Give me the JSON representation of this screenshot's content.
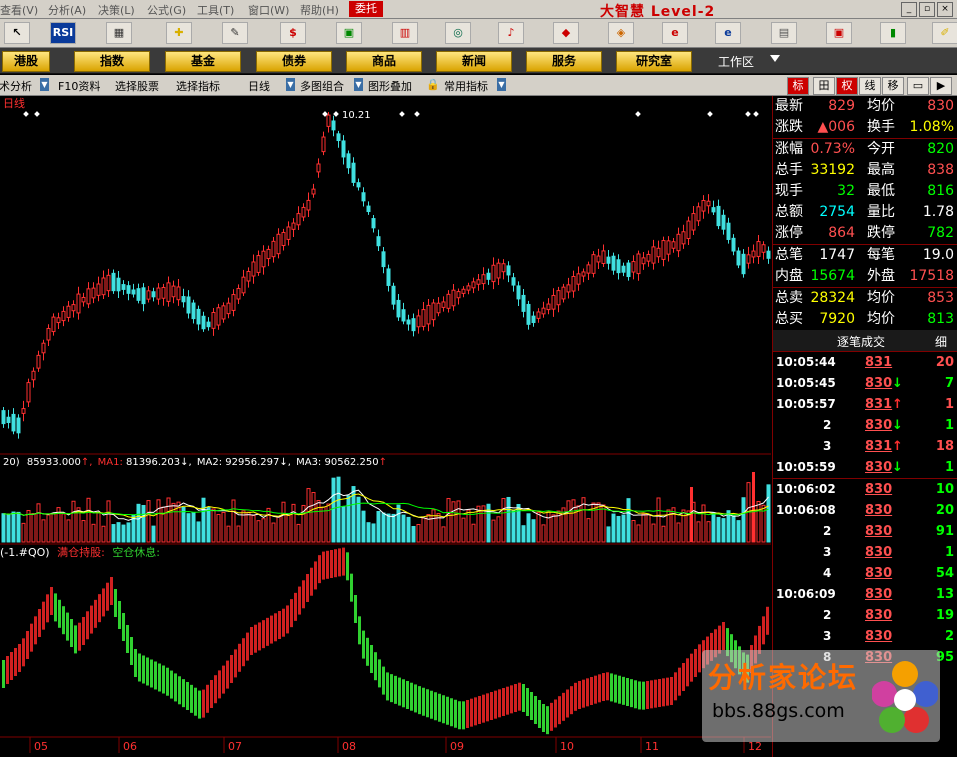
{
  "menubar": {
    "items": [
      "查看(V)",
      "分析(A)",
      "决策(L)",
      "公式(G)",
      "工具(T)",
      "窗口(W)",
      "帮助(H)"
    ],
    "entrust": "委托",
    "brand": "大智慧 Level-2"
  },
  "toolbar": {
    "rsi_label": "RSI",
    "dollar_label": "$"
  },
  "nav": {
    "buttons": [
      "港股",
      "指数",
      "基金",
      "债券",
      "商品",
      "新闻",
      "服务",
      "研究室"
    ],
    "workarea": "工作区"
  },
  "funcbar": {
    "items": [
      "技术分析",
      "F10资料",
      "选择股票",
      "选择指标",
      "日线",
      "多图组合",
      "图形叠加",
      "常用指标"
    ],
    "right_tabs": [
      "标",
      "田",
      "权",
      "线",
      "移"
    ]
  },
  "main_chart": {
    "period_label": "日线",
    "max_label": "10.21"
  },
  "volume": {
    "prefix": "20)",
    "vol_value": "85933.000",
    "ma1_label": "MA1:",
    "ma1_value": "81396.203",
    "ma2_label": "MA2:",
    "ma2_value": "92956.297",
    "ma3_label": "MA3:",
    "ma3_value": "90562.250"
  },
  "indicator": {
    "prefix": "(-1.#QO)",
    "label1": "满仓持股:",
    "label2": "空仓休息:"
  },
  "months": [
    "05",
    "06",
    "07",
    "08",
    "09",
    "10",
    "11",
    "12"
  ],
  "quote": {
    "rows": [
      {
        "l1": "最新",
        "v1": "829",
        "c1": "#ff5050",
        "l2": "均价",
        "v2": "830",
        "c2": "#ff5050"
      },
      {
        "l1": "涨跌",
        "v1": "▲006",
        "c1": "#ff5050",
        "l2": "换手",
        "v2": "1.08%",
        "c2": "#ffff00"
      },
      {
        "l1": "涨幅",
        "v1": "0.73%",
        "c1": "#ff5050",
        "l2": "今开",
        "v2": "820",
        "c2": "#00ff00"
      },
      {
        "l1": "总手",
        "v1": "33192",
        "c1": "#ffff00",
        "l2": "最高",
        "v2": "838",
        "c2": "#ff5050"
      },
      {
        "l1": "现手",
        "v1": "32",
        "c1": "#00ff00",
        "l2": "最低",
        "v2": "816",
        "c2": "#00ff00"
      },
      {
        "l1": "总额",
        "v1": "2754",
        "c1": "#00ffff",
        "l2": "量比",
        "v2": "1.78",
        "c2": "#ffffff"
      },
      {
        "l1": "涨停",
        "v1": "864",
        "c1": "#ff5050",
        "l2": "跌停",
        "v2": "782",
        "c2": "#00ff00"
      },
      {
        "l1": "总笔",
        "v1": "1747",
        "c1": "#ffffff",
        "l2": "每笔",
        "v2": "19.0",
        "c2": "#ffffff"
      },
      {
        "l1": "内盘",
        "v1": "15674",
        "c1": "#00ff00",
        "l2": "外盘",
        "v2": "17518",
        "c2": "#ff5050"
      },
      {
        "l1": "总卖",
        "v1": "28324",
        "c1": "#ffff00",
        "l2": "均价",
        "v2": "853",
        "c2": "#ff5050"
      },
      {
        "l1": "总买",
        "v1": "7920",
        "c1": "#ffff00",
        "l2": "均价",
        "v2": "813",
        "c2": "#00ff00"
      }
    ]
  },
  "ticks": {
    "header": "逐笔成交",
    "header_right": "细",
    "rows": [
      {
        "t": "10:05:44",
        "p": "831",
        "pc": "#ff5050",
        "a": "",
        "v": "20",
        "vc": "#ff5050"
      },
      {
        "t": "10:05:45",
        "p": "830",
        "pc": "#ff5050",
        "a": "↓",
        "v": "7",
        "vc": "#00ff00"
      },
      {
        "t": "10:05:57",
        "p": "831",
        "pc": "#ff5050",
        "a": "↑",
        "v": "1",
        "vc": "#ff5050"
      },
      {
        "t": "2",
        "p": "830",
        "pc": "#ff5050",
        "a": "↓",
        "v": "1",
        "vc": "#00ff00"
      },
      {
        "t": "3",
        "p": "831",
        "pc": "#ff5050",
        "a": "↑",
        "v": "18",
        "vc": "#ff5050"
      },
      {
        "t": "10:05:59",
        "p": "830",
        "pc": "#ff5050",
        "a": "↓",
        "v": "1",
        "vc": "#00ff00"
      },
      {
        "t": "10:06:02",
        "p": "830",
        "pc": "#ff5050",
        "a": "",
        "v": "10",
        "vc": "#00ff00"
      },
      {
        "t": "10:06:08",
        "p": "830",
        "pc": "#ff5050",
        "a": "",
        "v": "20",
        "vc": "#00ff00"
      },
      {
        "t": "2",
        "p": "830",
        "pc": "#ff5050",
        "a": "",
        "v": "91",
        "vc": "#00ff00"
      },
      {
        "t": "3",
        "p": "830",
        "pc": "#ff5050",
        "a": "",
        "v": "1",
        "vc": "#00ff00"
      },
      {
        "t": "4",
        "p": "830",
        "pc": "#ff5050",
        "a": "",
        "v": "54",
        "vc": "#00ff00"
      },
      {
        "t": "10:06:09",
        "p": "830",
        "pc": "#ff5050",
        "a": "",
        "v": "13",
        "vc": "#00ff00"
      },
      {
        "t": "2",
        "p": "830",
        "pc": "#ff5050",
        "a": "",
        "v": "19",
        "vc": "#00ff00"
      },
      {
        "t": "3",
        "p": "830",
        "pc": "#ff5050",
        "a": "",
        "v": "2",
        "vc": "#00ff00"
      },
      {
        "t": "8",
        "p": "830",
        "pc": "#ff5050",
        "a": "",
        "v": "95",
        "vc": "#00ff00"
      }
    ]
  },
  "watermark": {
    "title": "分析家论坛",
    "url": "bbs.88gs.com"
  },
  "colors": {
    "up": "#ff3030",
    "down": "#40e0e0",
    "ind_up": "#d02020",
    "ind_down": "#30d030",
    "frame": "#800000"
  }
}
